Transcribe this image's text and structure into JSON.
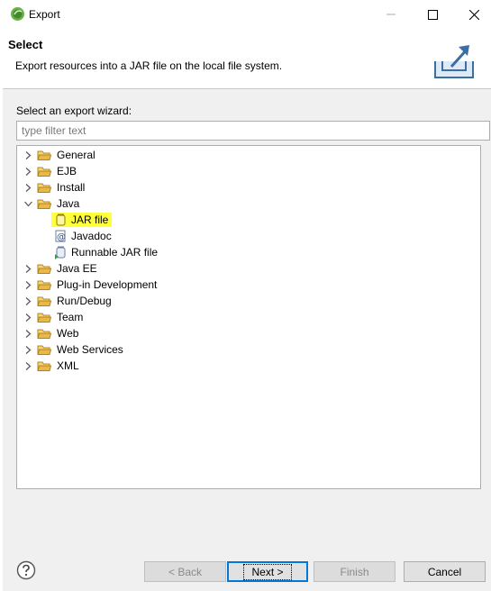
{
  "window": {
    "title": "Export",
    "controls": {
      "minimize": "minimize",
      "maximize": "maximize",
      "close": "close"
    }
  },
  "header": {
    "title": "Select",
    "description": "Export resources into a JAR file on the local file system."
  },
  "wizard": {
    "prompt": "Select an export wizard:",
    "filter_placeholder": "type filter text",
    "tree": [
      {
        "label": "General",
        "expanded": false
      },
      {
        "label": "EJB",
        "expanded": false
      },
      {
        "label": "Install",
        "expanded": false
      },
      {
        "label": "Java",
        "expanded": true,
        "children": [
          {
            "label": "JAR file",
            "selected": true,
            "icon": "jar-icon"
          },
          {
            "label": "Javadoc",
            "icon": "javadoc-icon"
          },
          {
            "label": "Runnable JAR file",
            "icon": "runnable-jar-icon"
          }
        ]
      },
      {
        "label": "Java EE",
        "expanded": false
      },
      {
        "label": "Plug-in Development",
        "expanded": false
      },
      {
        "label": "Run/Debug",
        "expanded": false
      },
      {
        "label": "Team",
        "expanded": false
      },
      {
        "label": "Web",
        "expanded": false
      },
      {
        "label": "Web Services",
        "expanded": false
      },
      {
        "label": "XML",
        "expanded": false
      }
    ]
  },
  "buttons": {
    "back": "< Back",
    "next": "Next >",
    "finish": "Finish",
    "cancel": "Cancel"
  },
  "colors": {
    "highlight": "#ffff3a",
    "folder": "#e8b84a",
    "accent": "#0078d7"
  }
}
